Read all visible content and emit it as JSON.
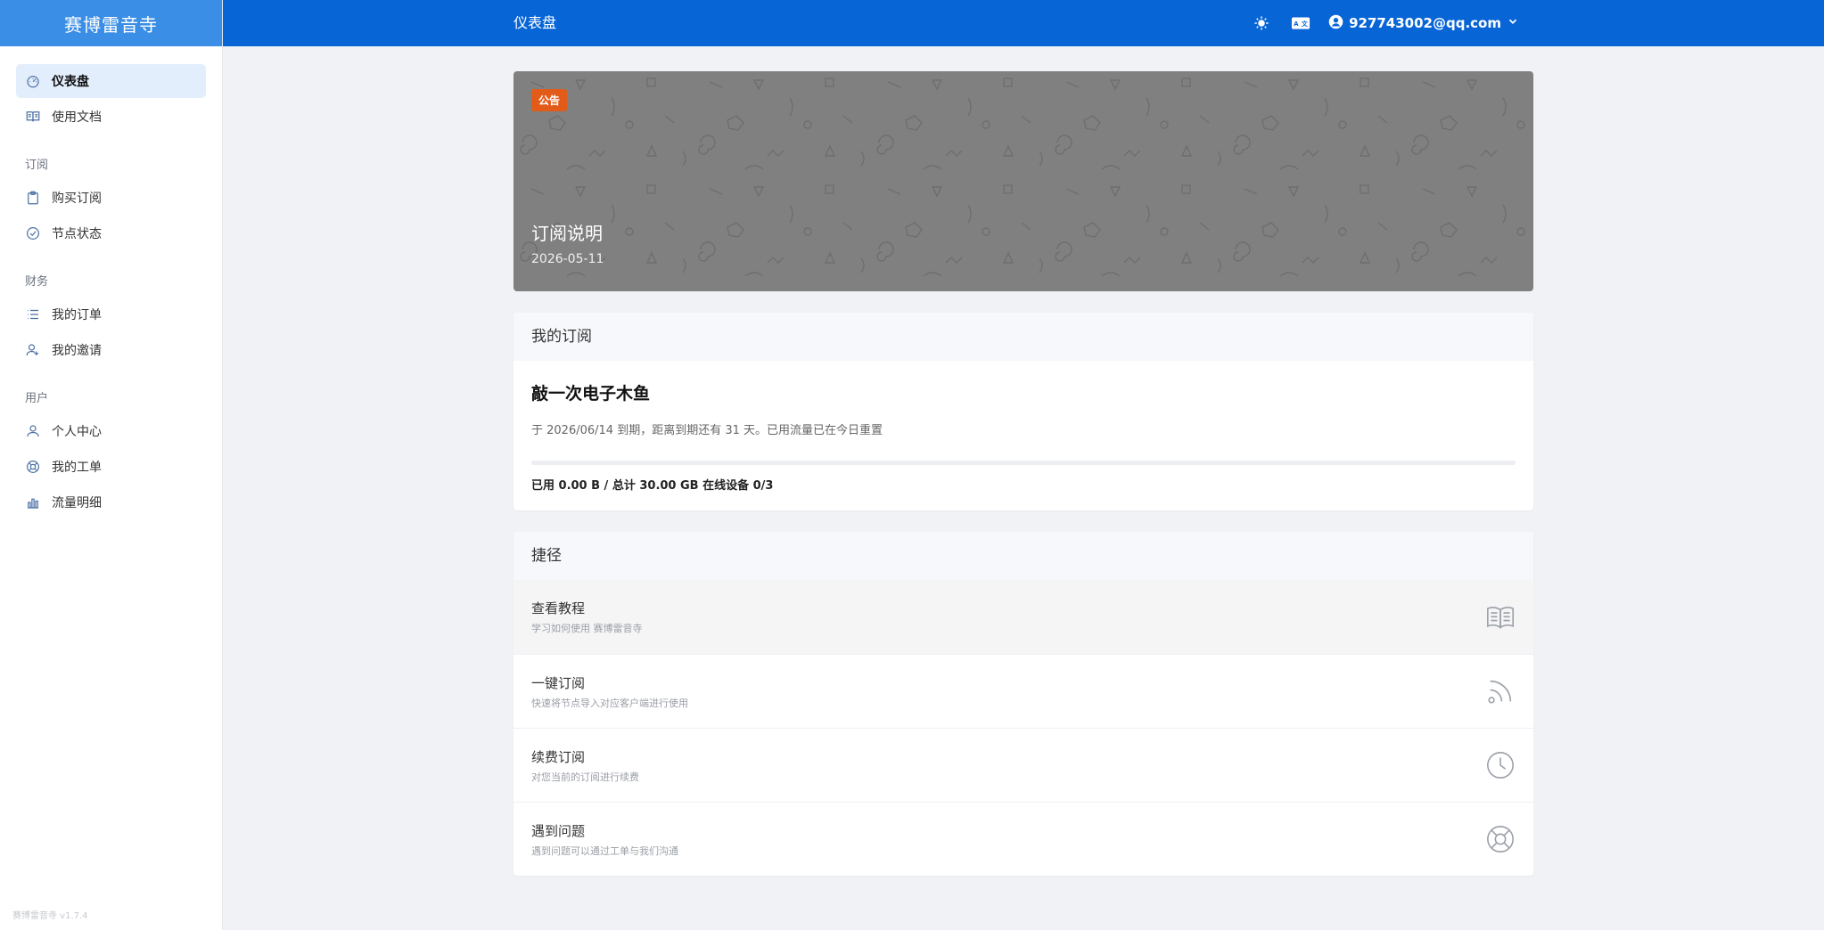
{
  "sidebar": {
    "brand": "赛博雷音寺",
    "items_top": [
      {
        "label": "仪表盘",
        "icon": "dashboard-icon",
        "active": true
      },
      {
        "label": "使用文档",
        "icon": "book-icon",
        "active": false
      }
    ],
    "groups": [
      {
        "label": "订阅",
        "items": [
          {
            "label": "购买订阅",
            "icon": "clipboard-icon"
          },
          {
            "label": "节点状态",
            "icon": "check-circle-icon"
          }
        ]
      },
      {
        "label": "财务",
        "items": [
          {
            "label": "我的订单",
            "icon": "list-icon"
          },
          {
            "label": "我的邀请",
            "icon": "users-icon"
          }
        ]
      },
      {
        "label": "用户",
        "items": [
          {
            "label": "个人中心",
            "icon": "user-icon"
          },
          {
            "label": "我的工单",
            "icon": "lifebuoy-icon"
          },
          {
            "label": "流量明细",
            "icon": "bar-chart-icon"
          }
        ]
      }
    ],
    "version": "赛博雷音寺 v1.7.4"
  },
  "header": {
    "title": "仪表盘",
    "user_email": "927743002@qq.com",
    "icons": [
      "theme-icon",
      "language-icon",
      "account-icon",
      "chevron-down-icon"
    ]
  },
  "announcement": {
    "badge": "公告",
    "title": "订阅说明",
    "date": "2026-05-11"
  },
  "subscription": {
    "heading": "我的订阅",
    "plan_name": "敲一次电子木鱼",
    "description": "于 2026/06/14 到期，距离到期还有 31 天。已用流量已在今日重置",
    "usage_text": "已用 0.00 B / 总计 30.00 GB 在线设备 0/3",
    "used_fraction": 0
  },
  "shortcuts": {
    "heading": "捷径",
    "items": [
      {
        "title": "查看教程",
        "desc": "学习如何使用 赛博雷音寺",
        "icon": "book-icon"
      },
      {
        "title": "一键订阅",
        "desc": "快速将节点导入对应客户端进行使用",
        "icon": "rss-icon"
      },
      {
        "title": "续费订阅",
        "desc": "对您当前的订阅进行续费",
        "icon": "clock-icon"
      },
      {
        "title": "遇到问题",
        "desc": "遇到问题可以通过工单与我们沟通",
        "icon": "lifebuoy-icon"
      }
    ]
  },
  "colors": {
    "header": "#0865d6",
    "brand_bg": "#3a8ee6",
    "badge": "#e35b19",
    "active_nav_bg": "#e3eefc",
    "banner_bg": "#808080"
  }
}
